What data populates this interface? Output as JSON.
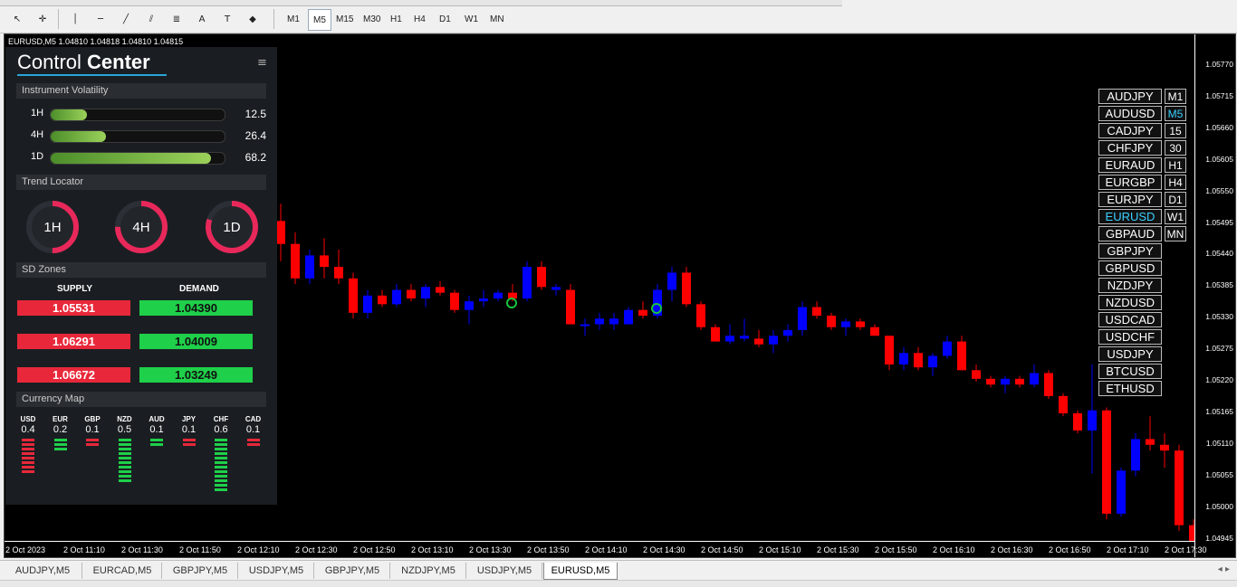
{
  "toolbar": {
    "icons": [
      "cursor-icon",
      "crosshair-icon",
      "vertical-line-icon",
      "horizontal-line-icon",
      "trendline-icon",
      "channel-icon",
      "fibonacci-icon",
      "text-icon",
      "label-icon",
      "shapes-icon"
    ],
    "timeframes": [
      {
        "label": "M1",
        "active": false
      },
      {
        "label": "M5",
        "active": true
      },
      {
        "label": "M15",
        "active": false
      },
      {
        "label": "M30",
        "active": false
      },
      {
        "label": "H1",
        "active": false
      },
      {
        "label": "H4",
        "active": false
      },
      {
        "label": "D1",
        "active": false
      },
      {
        "label": "W1",
        "active": false
      },
      {
        "label": "MN",
        "active": false
      }
    ]
  },
  "chart": {
    "header": "EURUSD,M5  1.04810 1.04818 1.04810 1.04815",
    "price_labels": [
      "1.05770",
      "1.05715",
      "1.05660",
      "1.05605",
      "1.05550",
      "1.05495",
      "1.05440",
      "1.05385",
      "1.05330",
      "1.05275",
      "1.05220",
      "1.05165",
      "1.05110",
      "1.05055",
      "1.05000",
      "1.04945"
    ],
    "time_labels": [
      "2 Oct 2023",
      "2 Oct 11:10",
      "2 Oct 11:30",
      "2 Oct 11:50",
      "2 Oct 12:10",
      "2 Oct 12:30",
      "2 Oct 12:50",
      "2 Oct 13:10",
      "2 Oct 13:30",
      "2 Oct 13:50",
      "2 Oct 14:10",
      "2 Oct 14:30",
      "2 Oct 14:50",
      "2 Oct 15:10",
      "2 Oct 15:30",
      "2 Oct 15:50",
      "2 Oct 16:10",
      "2 Oct 16:30",
      "2 Oct 16:50",
      "2 Oct 17:10",
      "2 Oct 17:30"
    ],
    "colors": {
      "bull": "#0000ff",
      "bear": "#ff0000",
      "marker": "#19c43c"
    }
  },
  "control_center": {
    "title_light": "Control ",
    "title_bold": "Center",
    "volatility": {
      "heading": "Instrument Volatility",
      "rows": [
        {
          "label": "1H",
          "value": "12.5",
          "fill": 0.21
        },
        {
          "label": "4H",
          "value": "26.4",
          "fill": 0.32
        },
        {
          "label": "1D",
          "value": "68.2",
          "fill": 0.92
        }
      ]
    },
    "trend": {
      "heading": "Trend Locator",
      "gauges": [
        {
          "label": "1H",
          "level": 0.5
        },
        {
          "label": "4H",
          "level": 0.75
        },
        {
          "label": "1D",
          "level": 0.8
        }
      ]
    },
    "sd_zones": {
      "heading": "SD Zones",
      "supply_label": "SUPPLY",
      "demand_label": "DEMAND",
      "supply": [
        "1.05531",
        "1.06291",
        "1.06672"
      ],
      "demand": [
        "1.04390",
        "1.04009",
        "1.03249"
      ]
    },
    "currency_map": {
      "heading": "Currency Map",
      "currencies": [
        {
          "code": "USD",
          "value": "0.4",
          "color": "#e8283a",
          "bars": 8
        },
        {
          "code": "EUR",
          "value": "0.2",
          "color": "#1fd04a",
          "bars": 3
        },
        {
          "code": "GBP",
          "value": "0.1",
          "color": "#e8283a",
          "bars": 2
        },
        {
          "code": "NZD",
          "value": "0.5",
          "color": "#1fd04a",
          "bars": 10
        },
        {
          "code": "AUD",
          "value": "0.1",
          "color": "#1fd04a",
          "bars": 2
        },
        {
          "code": "JPY",
          "value": "0.1",
          "color": "#e8283a",
          "bars": 2
        },
        {
          "code": "CHF",
          "value": "0.6",
          "color": "#1fd04a",
          "bars": 12
        },
        {
          "code": "CAD",
          "value": "0.1",
          "color": "#e8283a",
          "bars": 2
        }
      ]
    }
  },
  "symbol_list": {
    "symbols": [
      "AUDJPY",
      "AUDUSD",
      "CADJPY",
      "CHFJPY",
      "EURAUD",
      "EURGBP",
      "EURJPY",
      "EURUSD",
      "GBPAUD",
      "GBPJPY",
      "GBPUSD",
      "NZDJPY",
      "NZDUSD",
      "USDCAD",
      "USDCHF",
      "USDJPY",
      "BTCUSD",
      "ETHUSD"
    ],
    "selected_symbol": "EURUSD",
    "timeframes": [
      "M1",
      "M5",
      "15",
      "30",
      "H1",
      "H4",
      "D1",
      "W1",
      "MN"
    ],
    "selected_timeframe": "M5"
  },
  "tabs": [
    {
      "label": "AUDJPY,M5",
      "active": false
    },
    {
      "label": "EURCAD,M5",
      "active": false
    },
    {
      "label": "GBPJPY,M5",
      "active": false
    },
    {
      "label": "USDJPY,M5",
      "active": false
    },
    {
      "label": "GBPJPY,M5",
      "active": false
    },
    {
      "label": "NZDJPY,M5",
      "active": false
    },
    {
      "label": "USDJPY,M5",
      "active": false
    },
    {
      "label": "EURUSD,M5",
      "active": true
    }
  ],
  "tab_arrows": "◂ ▸"
}
